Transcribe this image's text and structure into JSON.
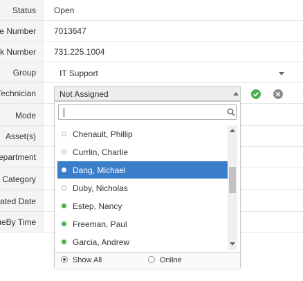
{
  "form": {
    "rows": [
      {
        "label": "Status",
        "value": "Open"
      },
      {
        "label": "e Number",
        "value": "7013647"
      },
      {
        "label": "k Number",
        "value": "731.225.1004"
      },
      {
        "label": "Group",
        "value": ""
      },
      {
        "label": "Technician",
        "value": ""
      },
      {
        "label": "Mode",
        "value": ""
      },
      {
        "label": "Asset(s)",
        "value": ""
      },
      {
        "label": "epartment",
        "value": ""
      },
      {
        "label": "Category",
        "value": ""
      },
      {
        "label": "ated Date",
        "value": ""
      },
      {
        "label": "ueBy Time",
        "value": ""
      }
    ],
    "group_value": "IT Support",
    "technician_value": "Not Assigned"
  },
  "dropdown": {
    "search_value": "",
    "items": [
      {
        "name": "Chenault, Phillip",
        "status": "offline"
      },
      {
        "name": "Currlin, Charlie",
        "status": "offline"
      },
      {
        "name": "Dang, Michael",
        "status": "selected"
      },
      {
        "name": "Duby, Nicholas",
        "status": "offline"
      },
      {
        "name": "Estep, Nancy",
        "status": "online"
      },
      {
        "name": "Freeman, Paul",
        "status": "online"
      },
      {
        "name": "Garcia, Andrew",
        "status": "online"
      }
    ],
    "filter_options": {
      "show_all": "Show All",
      "online": "Online",
      "selected": "show_all"
    }
  },
  "colors": {
    "online": "#4caf50",
    "offline_border": "#b5b5b5",
    "selected_bg": "#3a7dc9",
    "ok_green": "#4caf50",
    "cancel_gray": "#8c8c8c"
  },
  "icons": {
    "ok": "check-circle-icon",
    "cancel": "close-circle-icon",
    "search": "search-icon"
  }
}
